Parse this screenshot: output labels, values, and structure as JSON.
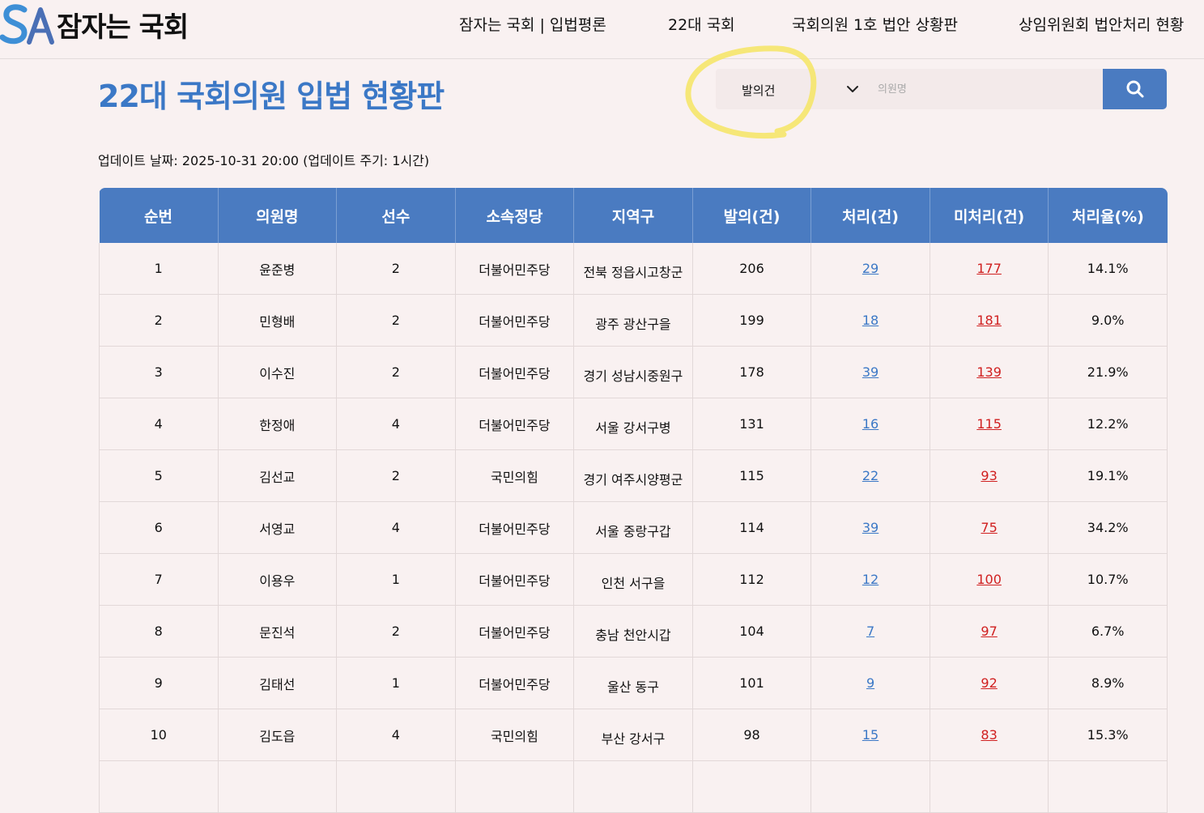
{
  "header": {
    "logo_text": "잠자는 국회",
    "logo_mark": "SA",
    "nav": [
      "잠자는 국회 | 입법평론",
      "22대 국회",
      "국회의원 1호 법안 상황판",
      "상임위원회 법안처리 현황"
    ]
  },
  "page_title": "22대 국회의원 입법 현황판",
  "search": {
    "select_value": "발의건",
    "placeholder": "의원명"
  },
  "update_text": "업데이트 날짜: 2025-10-31 20:00 (업데이트 주기: 1시간)",
  "table": {
    "headers": [
      "순번",
      "의원명",
      "선수",
      "소속정당",
      "지역구",
      "발의(건)",
      "처리(건)",
      "미처리(건)",
      "처리율(%)"
    ],
    "rows": [
      {
        "rank": "1",
        "name": "윤준병",
        "terms": "2",
        "party": "더불어민주당",
        "region": "전북 정읍시고창군",
        "proposed": "206",
        "processed": "29",
        "unprocessed": "177",
        "rate": "14.1%"
      },
      {
        "rank": "2",
        "name": "민형배",
        "terms": "2",
        "party": "더불어민주당",
        "region": "광주 광산구을",
        "proposed": "199",
        "processed": "18",
        "unprocessed": "181",
        "rate": "9.0%"
      },
      {
        "rank": "3",
        "name": "이수진",
        "terms": "2",
        "party": "더불어민주당",
        "region": "경기 성남시중원구",
        "proposed": "178",
        "processed": "39",
        "unprocessed": "139",
        "rate": "21.9%"
      },
      {
        "rank": "4",
        "name": "한정애",
        "terms": "4",
        "party": "더불어민주당",
        "region": "서울 강서구병",
        "proposed": "131",
        "processed": "16",
        "unprocessed": "115",
        "rate": "12.2%"
      },
      {
        "rank": "5",
        "name": "김선교",
        "terms": "2",
        "party": "국민의힘",
        "region": "경기 여주시양평군",
        "proposed": "115",
        "processed": "22",
        "unprocessed": "93",
        "rate": "19.1%"
      },
      {
        "rank": "6",
        "name": "서영교",
        "terms": "4",
        "party": "더불어민주당",
        "region": "서울 중랑구갑",
        "proposed": "114",
        "processed": "39",
        "unprocessed": "75",
        "rate": "34.2%"
      },
      {
        "rank": "7",
        "name": "이용우",
        "terms": "1",
        "party": "더불어민주당",
        "region": "인천 서구을",
        "proposed": "112",
        "processed": "12",
        "unprocessed": "100",
        "rate": "10.7%"
      },
      {
        "rank": "8",
        "name": "문진석",
        "terms": "2",
        "party": "더불어민주당",
        "region": "충남 천안시갑",
        "proposed": "104",
        "processed": "7",
        "unprocessed": "97",
        "rate": "6.7%"
      },
      {
        "rank": "9",
        "name": "김태선",
        "terms": "1",
        "party": "더불어민주당",
        "region": "울산 동구",
        "proposed": "101",
        "processed": "9",
        "unprocessed": "92",
        "rate": "8.9%"
      },
      {
        "rank": "10",
        "name": "김도읍",
        "terms": "4",
        "party": "국민의힘",
        "region": "부산 강서구",
        "proposed": "98",
        "processed": "15",
        "unprocessed": "83",
        "rate": "15.3%"
      },
      {
        "rank": "",
        "name": "",
        "terms": "",
        "party": "",
        "region": "",
        "proposed": "",
        "processed": "",
        "unprocessed": "",
        "rate": ""
      }
    ]
  },
  "colors": {
    "accent": "#3b78c6",
    "header_bg": "#4a7bc1",
    "unprocessed": "#d02020",
    "highlight_circle": "#f5e66a",
    "page_bg": "#f9f1f1"
  },
  "icons": [
    "sa-logo-icon",
    "chevron-down-icon",
    "search-icon"
  ]
}
